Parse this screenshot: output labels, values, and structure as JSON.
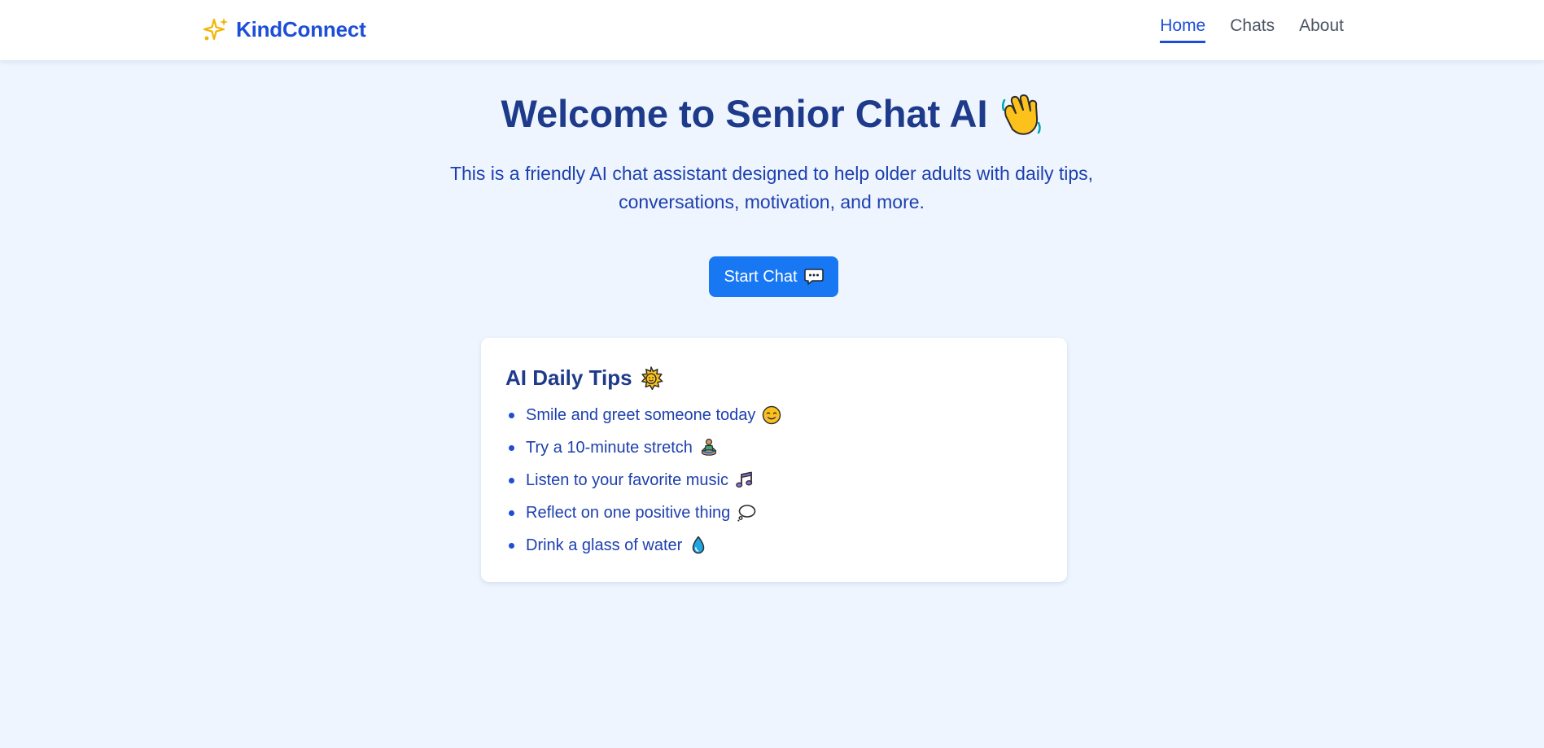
{
  "nav": {
    "brand": "KindConnect",
    "brand_icon": "sparkles-icon",
    "links": [
      {
        "label": "Home",
        "active": true
      },
      {
        "label": "Chats",
        "active": false
      },
      {
        "label": "About",
        "active": false
      }
    ]
  },
  "hero": {
    "title": "Welcome to Senior Chat AI",
    "title_icon": "waving-hand-icon",
    "subtitle": "This is a friendly AI chat assistant designed to help older adults with daily tips, conversations, motivation, and more.",
    "button_label": "Start Chat",
    "button_icon": "speech-bubble-icon"
  },
  "tips": {
    "heading": "AI Daily Tips",
    "heading_icon": "sun-icon",
    "items": [
      {
        "text": "Smile and greet someone today",
        "icon": "smiling-face-icon"
      },
      {
        "text": "Try a 10-minute stretch",
        "icon": "meditation-icon"
      },
      {
        "text": "Listen to your favorite music",
        "icon": "music-notes-icon"
      },
      {
        "text": "Reflect on one positive thing",
        "icon": "thought-bubble-icon"
      },
      {
        "text": "Drink a glass of water",
        "icon": "water-drop-icon"
      }
    ]
  },
  "colors": {
    "background": "#eef5fe",
    "brand": "#1d4ed8",
    "primary_button": "#1877f2",
    "heading": "#1e3a8a",
    "body_text": "#1e40af",
    "nav_text": "#4b5563"
  }
}
